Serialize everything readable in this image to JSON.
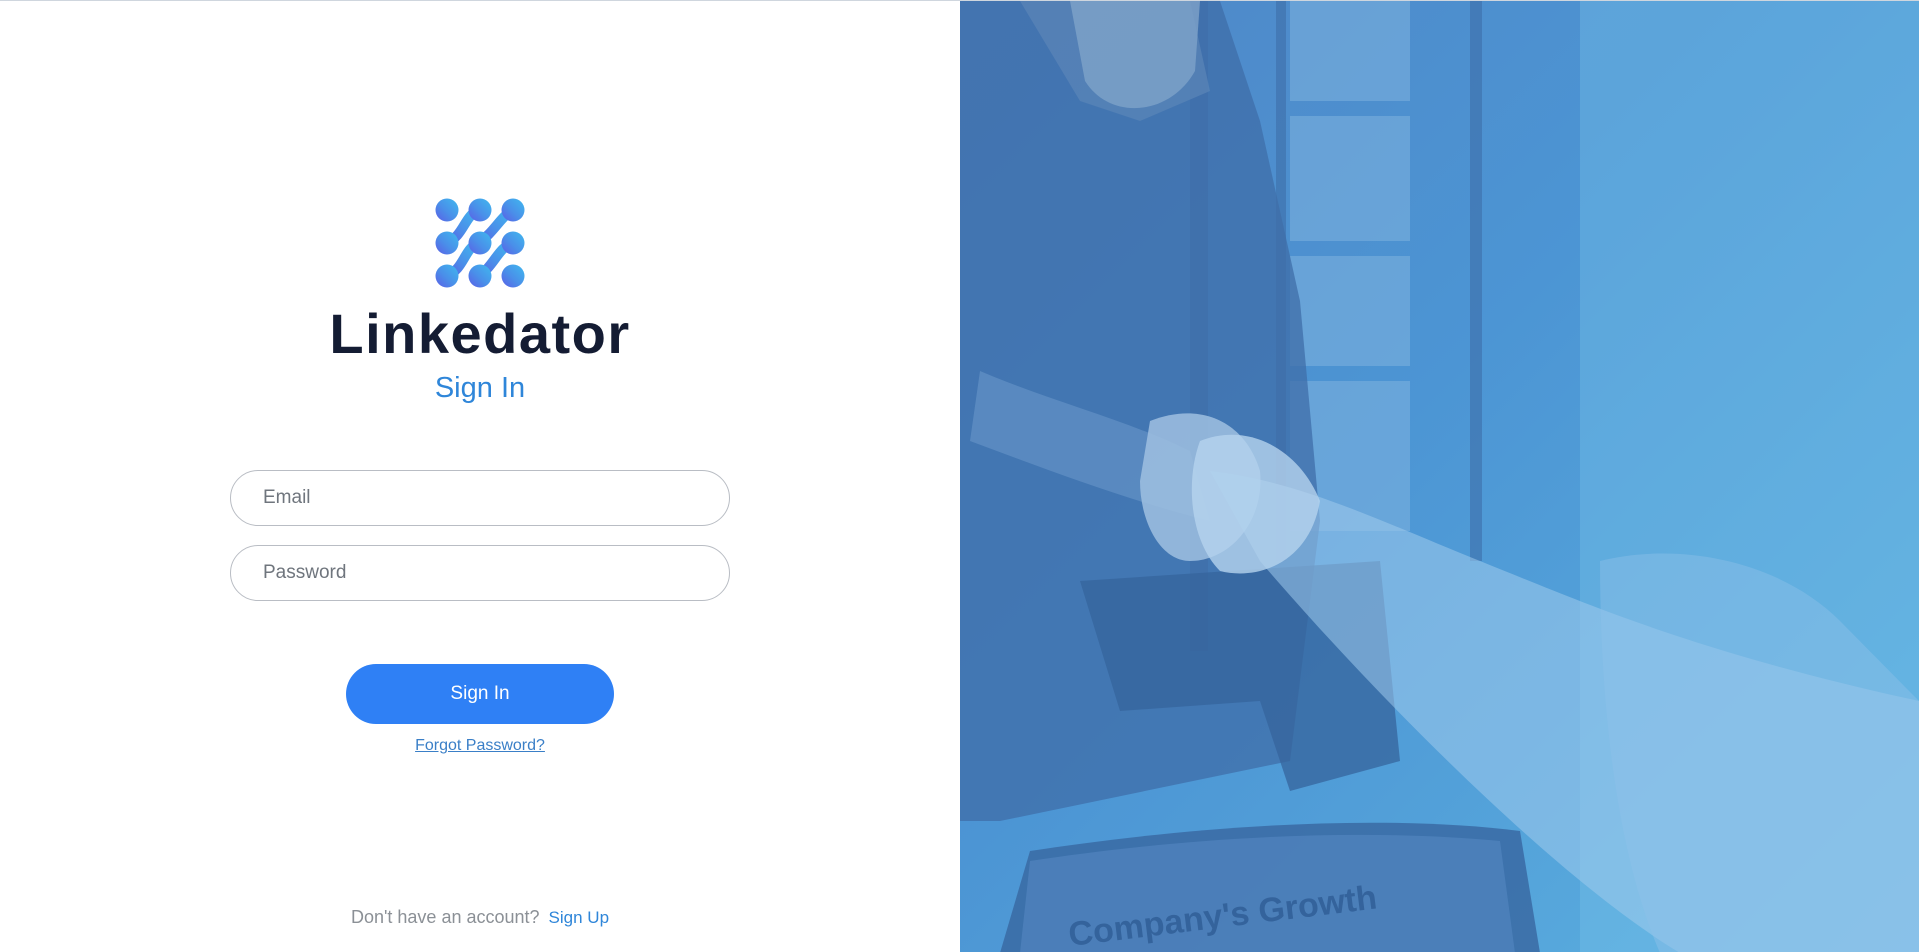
{
  "brand": {
    "name": "Linkedator",
    "logo_icon": "linkedator-dots-logo",
    "logo_colors": [
      "#3fb5ef",
      "#4a8fe9",
      "#5b5ee6"
    ]
  },
  "form": {
    "title": "Sign In",
    "email_placeholder": "Email",
    "password_placeholder": "Password",
    "submit_label": "Sign In",
    "forgot_label": "Forgot Password?"
  },
  "footer": {
    "prompt": "Don't have an account?",
    "signup_label": "Sign Up"
  },
  "hero": {
    "image": "handshake-photo",
    "overlay_color": "#4a90d2",
    "laptop_text": "Company's Growth"
  },
  "colors": {
    "accent": "#2f80f5",
    "link": "#2f86d9",
    "brand_text": "#141c33"
  }
}
